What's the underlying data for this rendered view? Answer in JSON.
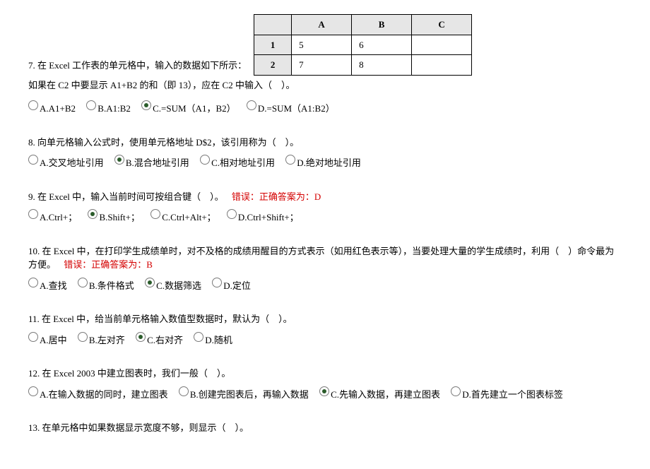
{
  "table": {
    "headers": [
      "",
      "A",
      "B",
      "C"
    ],
    "rows": [
      {
        "h": "1",
        "a": "5",
        "b": "6",
        "c": ""
      },
      {
        "h": "2",
        "a": "7",
        "b": "8",
        "c": ""
      }
    ]
  },
  "q7": {
    "lead": "7. 在 Excel 工作表的单元格中，输入的数据如下所示：",
    "trail": "如果在 C2 中要显示 A1+B2 的和（即 13），应在 C2 中输入（　）。",
    "opts": {
      "a": "A.A1+B2",
      "b": "B.A1:B2",
      "c": "C.=SUM（A1，B2）",
      "d": "D.=SUM（A1:B2）"
    }
  },
  "q8": {
    "text": "8. 向单元格输入公式时，使用单元格地址 D$2，该引用称为（　）。",
    "opts": {
      "a": "A.交叉地址引用",
      "b": "B.混合地址引用",
      "c": "C.相对地址引用",
      "d": "D.绝对地址引用"
    }
  },
  "q9": {
    "text": "9. 在 Excel 中，输入当前时间可按组合键（　）。",
    "err": "错误：正确答案为：D",
    "opts": {
      "a": "A.Ctrl+；",
      "b": "B.Shift+；",
      "c": "C.Ctrl+Alt+；",
      "d": "D.Ctrl+Shift+；"
    }
  },
  "q10": {
    "text": "10. 在 Excel 中，在打印学生成绩单时，对不及格的成绩用醒目的方式表示（如用红色表示等），当要处理大量的学生成绩时，利用（　）命令最为方便。",
    "err": "错误：正确答案为：B",
    "opts": {
      "a": "A.查找",
      "b": "B.条件格式",
      "c": "C.数据筛选",
      "d": "D.定位"
    }
  },
  "q11": {
    "text": "11. 在 Excel 中，给当前单元格输入数值型数据时，默认为（　）。",
    "opts": {
      "a": "A.居中",
      "b": "B.左对齐",
      "c": "C.右对齐",
      "d": "D.随机"
    }
  },
  "q12": {
    "text": "12. 在 Excel 2003 中建立图表时，我们一般（　）。",
    "opts": {
      "a": "A.在输入数据的同时，建立图表",
      "b": "B.创建完图表后，再输入数据",
      "c": "C.先输入数据，再建立图表",
      "d": "D.首先建立一个图表标签"
    }
  },
  "q13": {
    "text": "13. 在单元格中如果数据显示宽度不够，则显示（　）。"
  }
}
